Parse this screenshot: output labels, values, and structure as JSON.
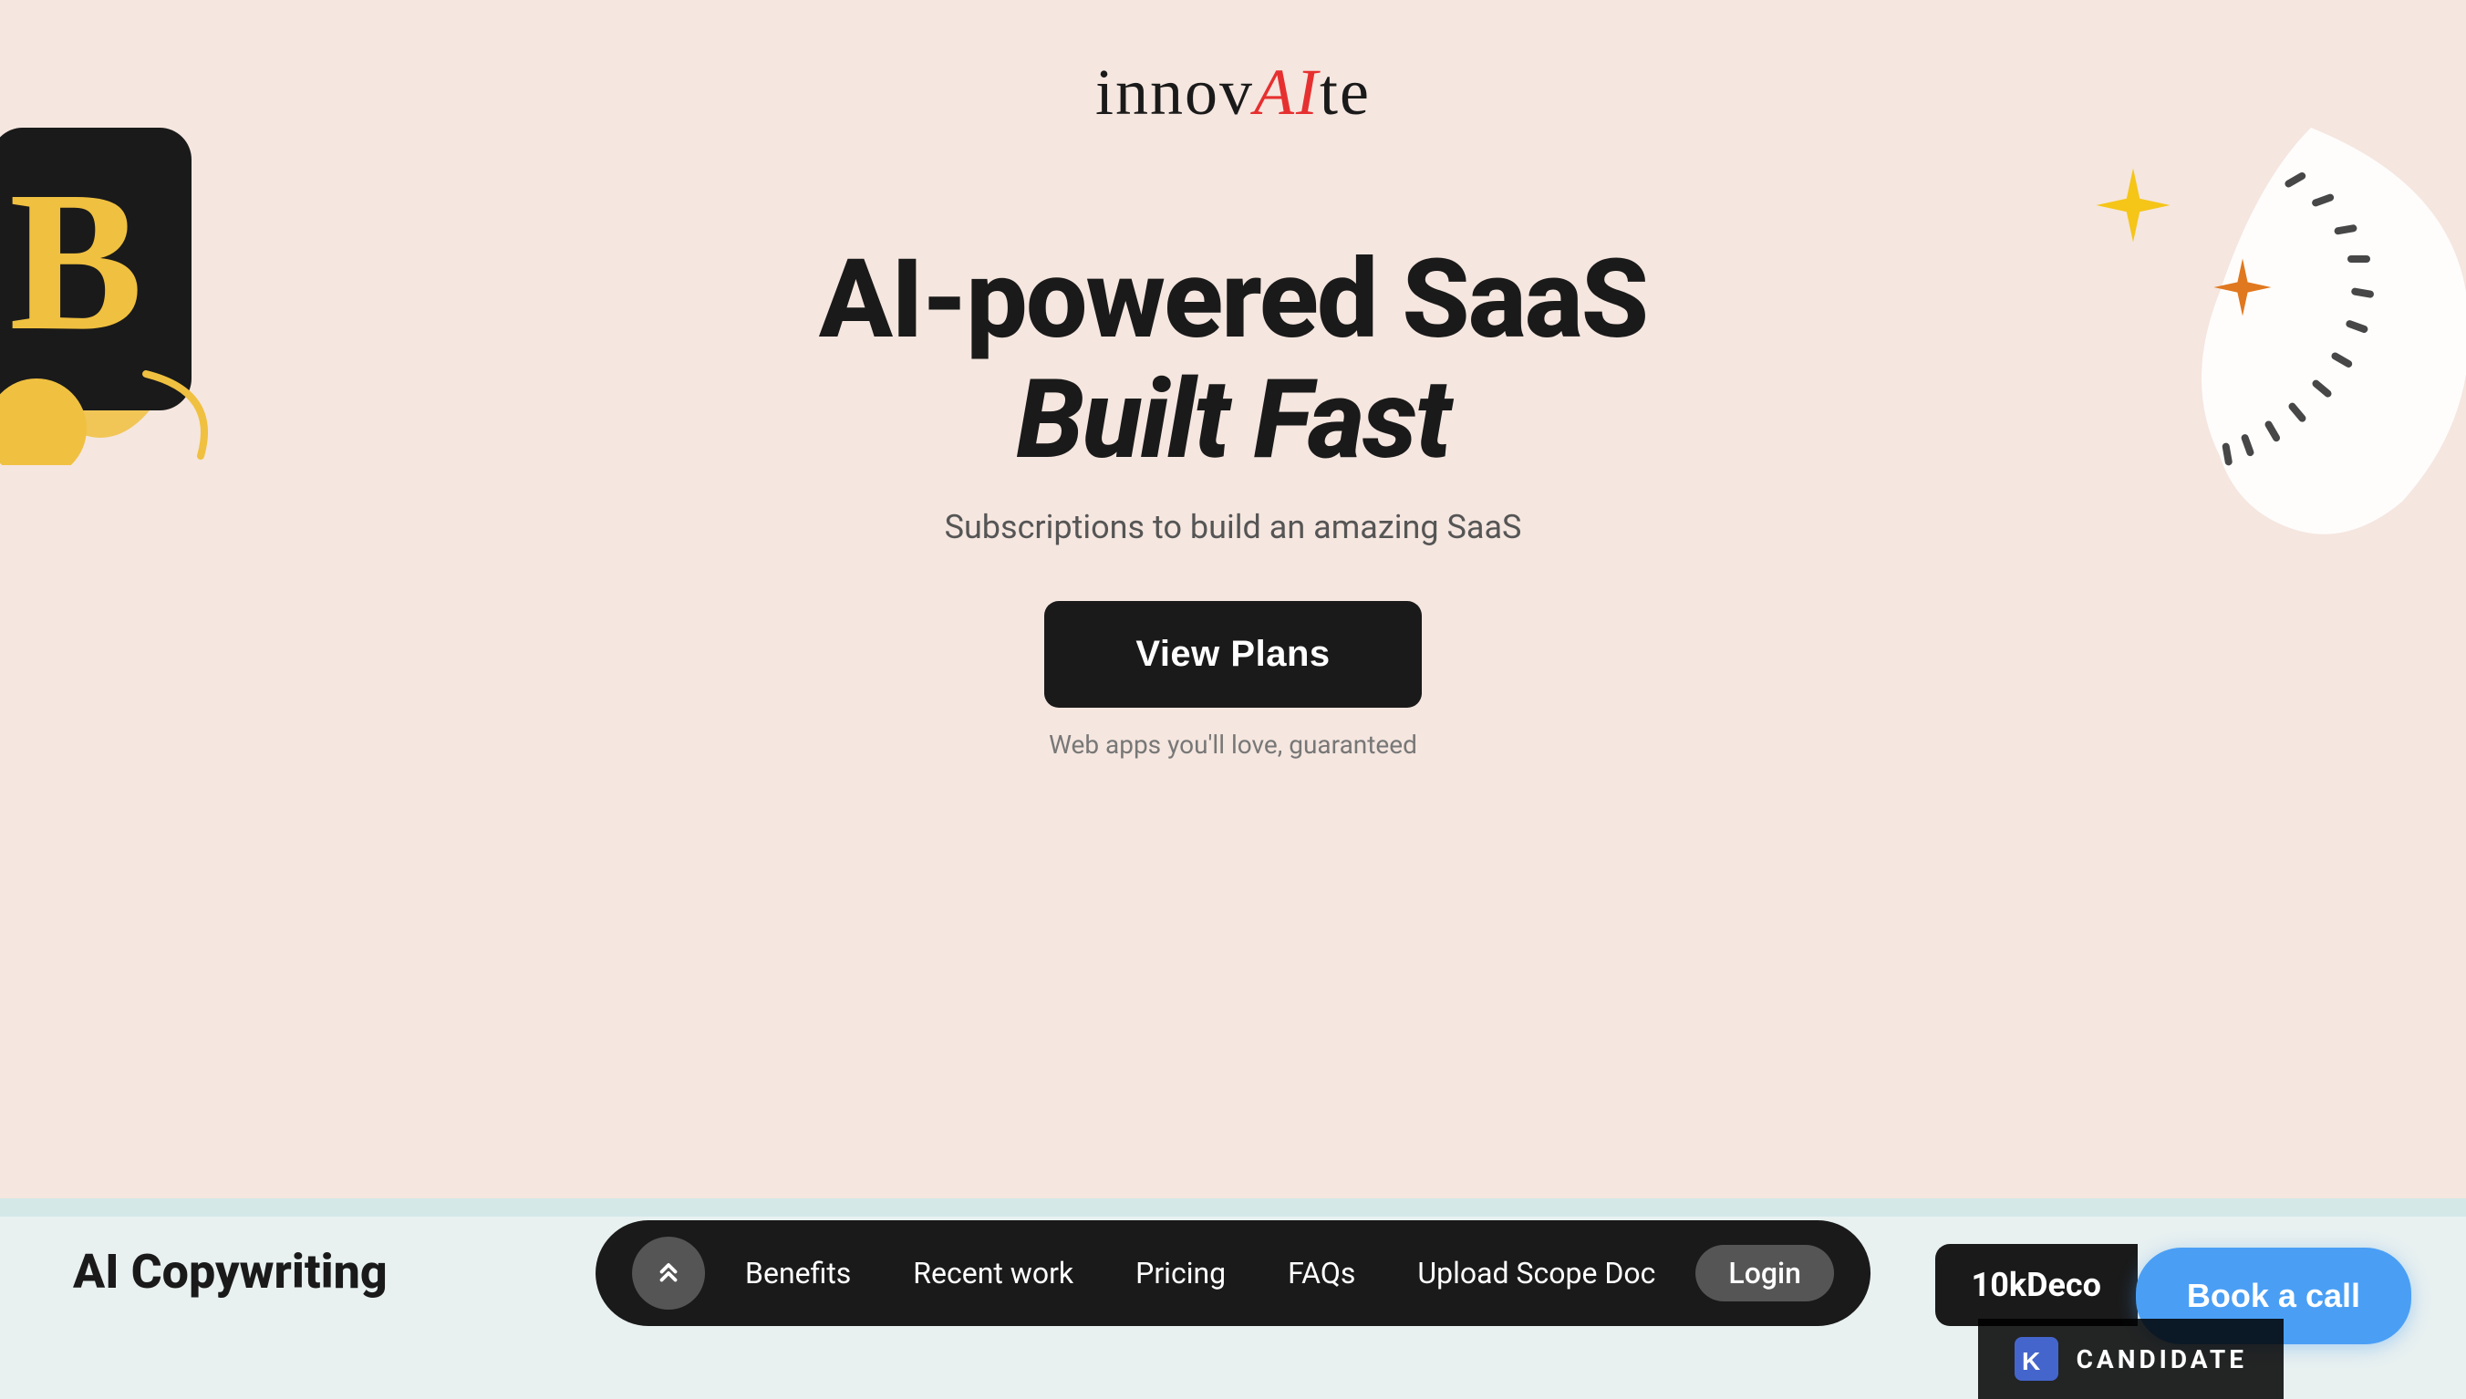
{
  "logo": {
    "prefix": "innov",
    "highlight": "AI",
    "suffix": "te"
  },
  "hero": {
    "title_line1": "AI-powered SaaS",
    "title_line2": "Built Fast",
    "subtitle": "Subscriptions to build an amazing SaaS",
    "cta_button": "View Plans",
    "guarantee": "Web apps you'll love, guaranteed"
  },
  "bottom_section": {
    "text": "AI Copywriting"
  },
  "navbar": {
    "scroll_icon": "chevrons-up",
    "items": [
      {
        "label": "Benefits",
        "id": "benefits"
      },
      {
        "label": "Recent work",
        "id": "recent-work"
      },
      {
        "label": "Pricing",
        "id": "pricing"
      },
      {
        "label": "FAQs",
        "id": "faqs"
      },
      {
        "label": "Upload Scope Doc",
        "id": "upload-scope"
      }
    ],
    "login_label": "Login"
  },
  "badge_10k": {
    "text": "10kDeco"
  },
  "book_call": {
    "label": "Book a call"
  },
  "candidate": {
    "label": "CANDIDATE"
  },
  "colors": {
    "background": "#f5e6df",
    "navbar_bg": "#1a1a1a",
    "cta_bg": "#1a1a1a",
    "logo_highlight": "#e63030",
    "star_yellow": "#f5c518",
    "star_orange": "#e07820",
    "book_call_bg": "#4a9ff5",
    "bottom_bg": "#d4e8e8"
  }
}
